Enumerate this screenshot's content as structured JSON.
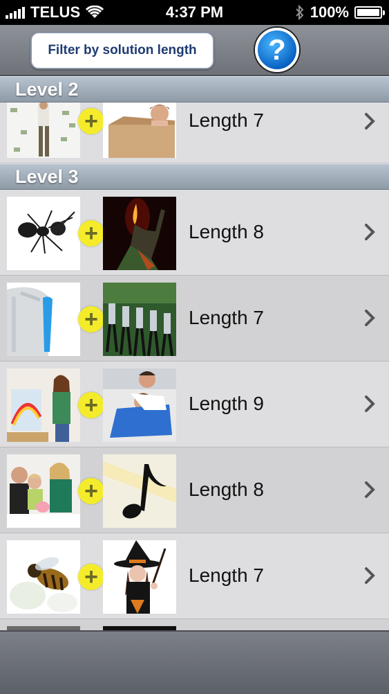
{
  "status_bar": {
    "carrier": "TELUS",
    "time": "4:37 PM",
    "battery": "100%"
  },
  "toolbar": {
    "filter_label": "Filter by solution length",
    "help_label": "?"
  },
  "sections": [
    {
      "title": "Level 2"
    },
    {
      "title": "Level 3"
    }
  ],
  "rows": [
    {
      "label": "Length 7",
      "left_image": "woman-money-photo",
      "right_image": "box-child-photo"
    },
    {
      "label": "Length 8",
      "left_image": "ant-photo",
      "right_image": "fire-performer-photo"
    },
    {
      "label": "Length 7",
      "left_image": "shoulder-bone-photo",
      "right_image": "marching-band-photo"
    },
    {
      "label": "Length 9",
      "left_image": "painter-woman-photo",
      "right_image": "wrestling-men-photo"
    },
    {
      "label": "Length 8",
      "left_image": "family-piggybank-photo",
      "right_image": "music-note-photo"
    },
    {
      "label": "Length 7",
      "left_image": "bee-photo",
      "right_image": "witch-photo"
    }
  ],
  "plus_symbol": "+",
  "colors": {
    "accent_yellow": "#f4ec2b",
    "help_blue": "#0a63c4",
    "filter_text": "#1f3b72"
  }
}
